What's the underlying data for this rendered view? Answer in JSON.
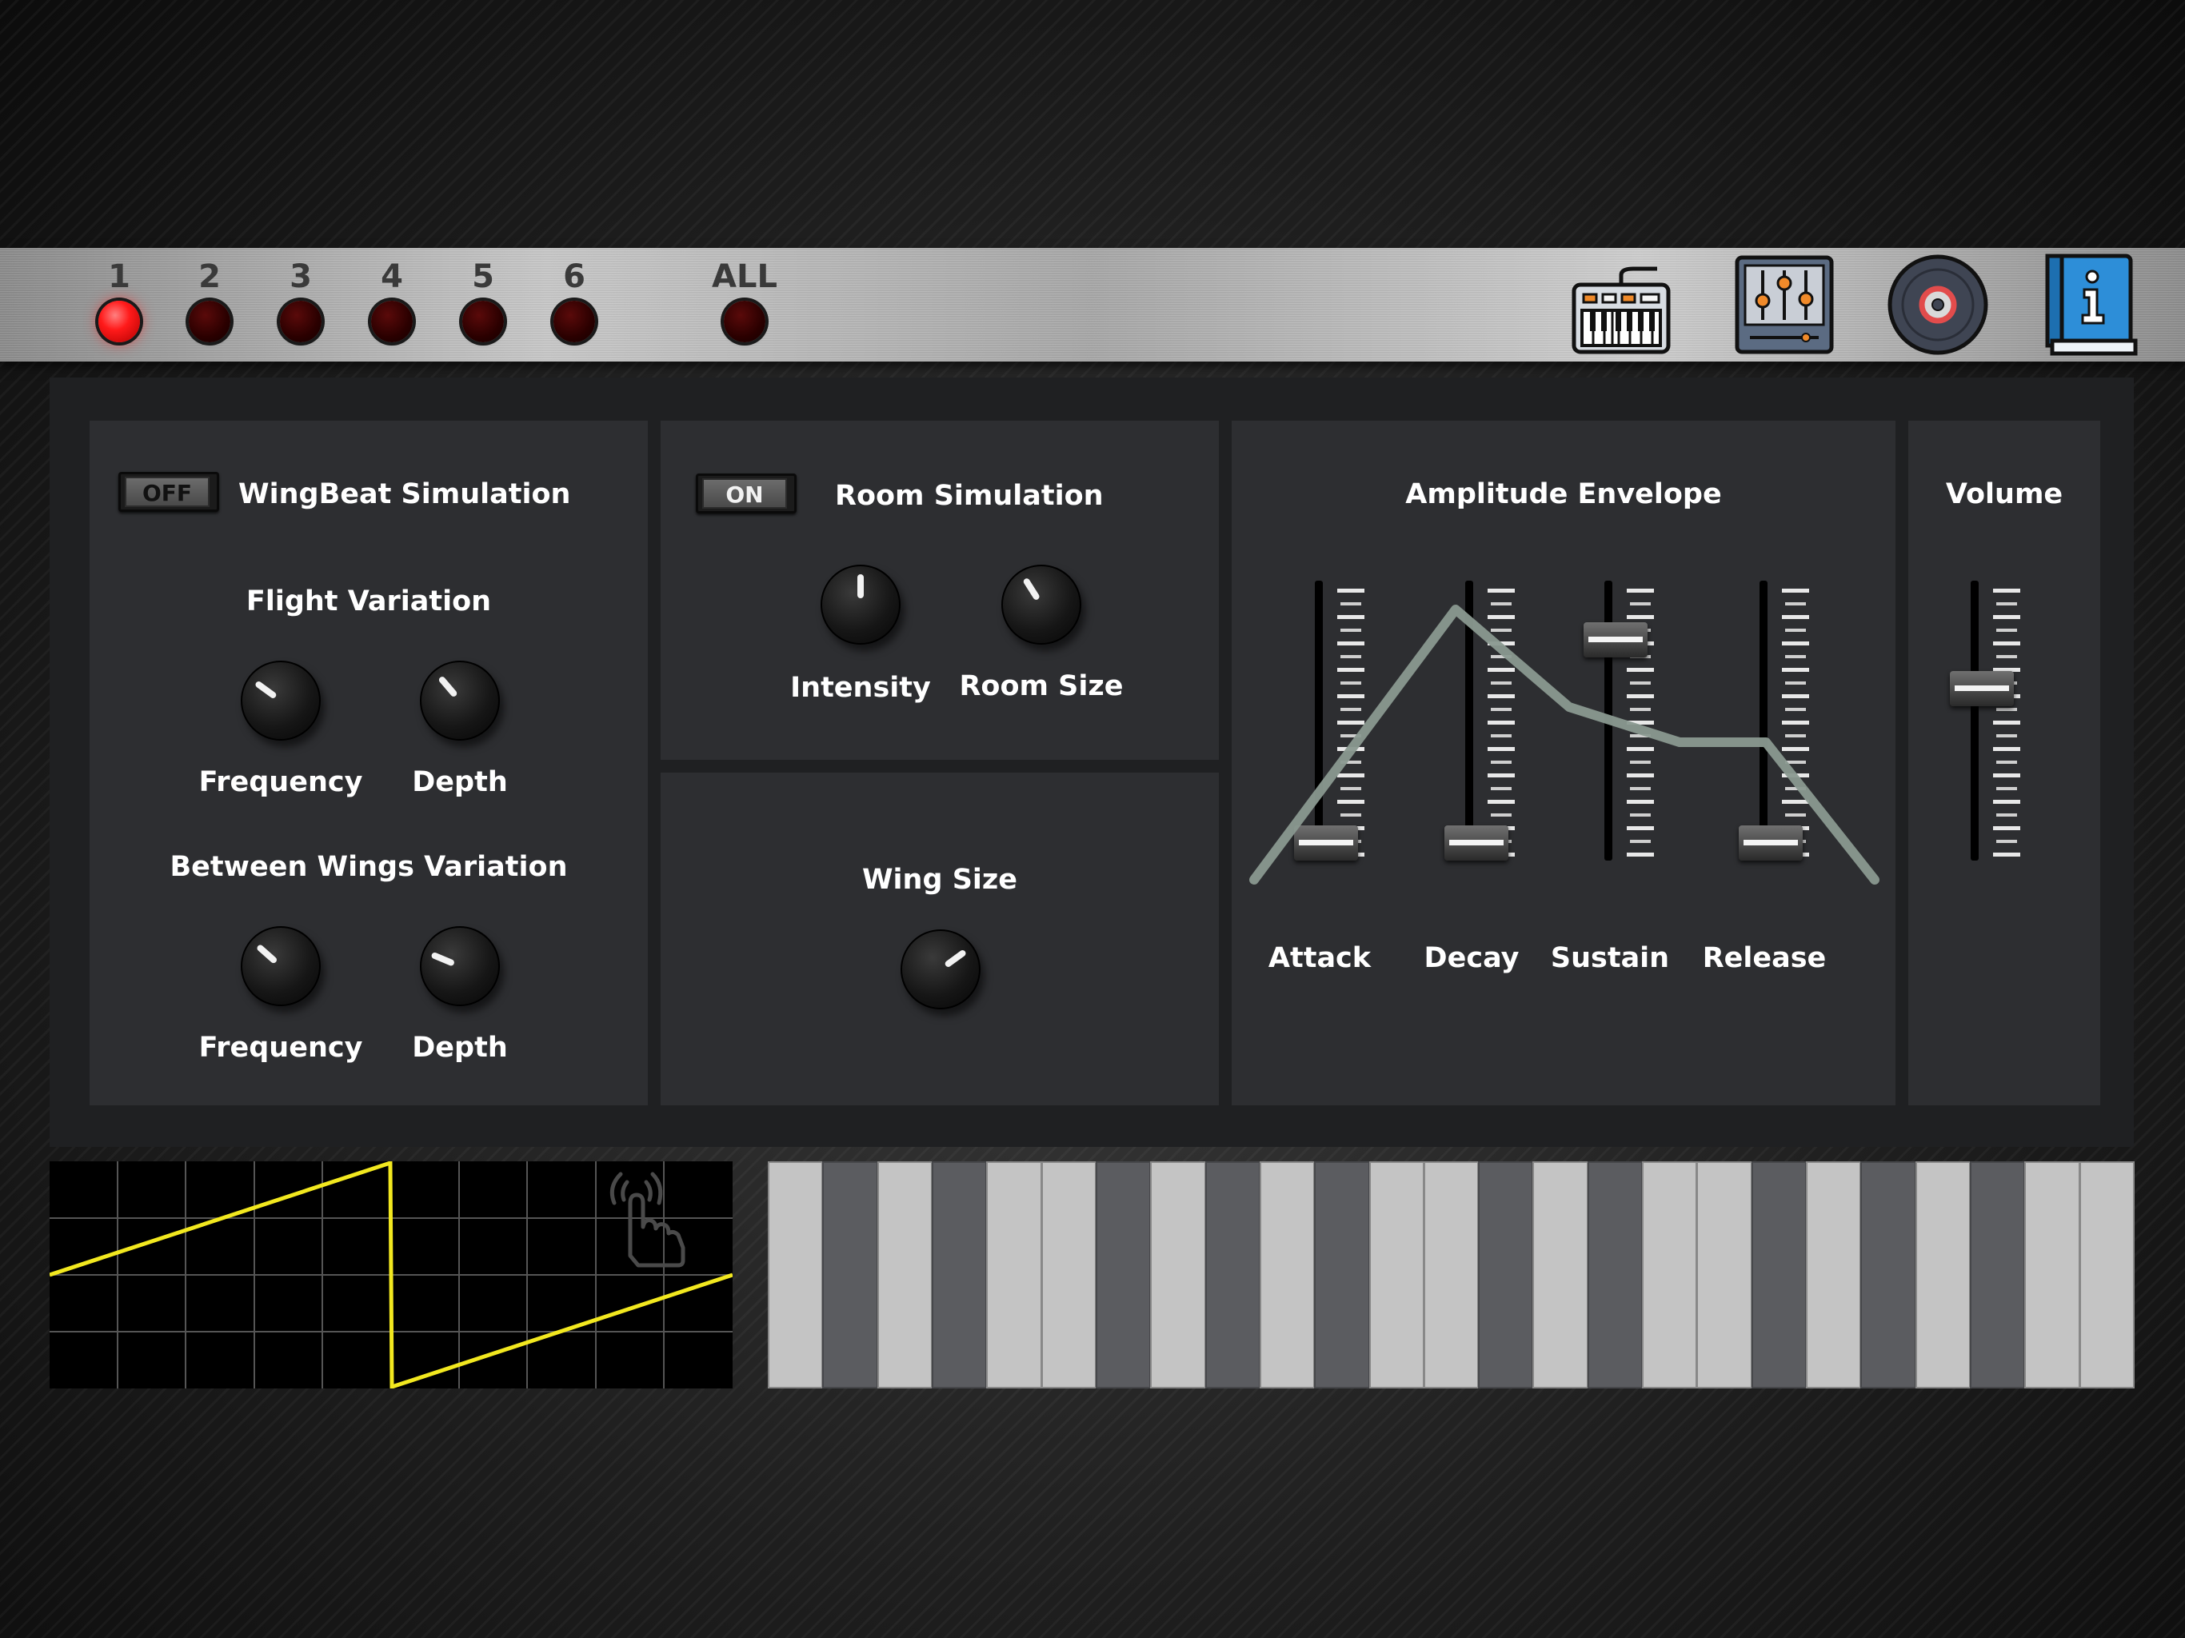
{
  "channels": {
    "items": [
      {
        "label": "1",
        "active": true
      },
      {
        "label": "2",
        "active": false
      },
      {
        "label": "3",
        "active": false
      },
      {
        "label": "4",
        "active": false
      },
      {
        "label": "5",
        "active": false
      },
      {
        "label": "6",
        "active": false
      }
    ],
    "all_label": "ALL"
  },
  "toolbar_icons": [
    "keyboard-icon",
    "mixer-icon",
    "vinyl-record-icon",
    "info-book-icon"
  ],
  "wingbeat": {
    "toggle_label": "OFF",
    "title": "WingBeat Simulation",
    "flight_title": "Flight Variation",
    "flight_frequency_label": "Frequency",
    "flight_depth_label": "Depth",
    "between_title": "Between Wings Variation",
    "between_frequency_label": "Frequency",
    "between_depth_label": "Depth"
  },
  "room": {
    "toggle_label": "ON",
    "title": "Room Simulation",
    "intensity_label": "Intensity",
    "room_size_label": "Room Size"
  },
  "wing": {
    "title": "Wing Size"
  },
  "envelope": {
    "title": "Amplitude Envelope",
    "attack_label": "Attack",
    "decay_label": "Decay",
    "sustain_label": "Sustain",
    "release_label": "Release",
    "levels": {
      "attack": 0.0,
      "decay": 0.0,
      "sustain": 0.83,
      "release": 0.0
    }
  },
  "volume": {
    "title": "Volume",
    "level": 0.63
  },
  "knob_levels": {
    "flight_frequency": 0.3,
    "flight_depth": 0.35,
    "between_frequency": 0.32,
    "between_depth": 0.25,
    "intensity": 0.5,
    "room_size": 0.38,
    "wing_size": 0.7
  },
  "scope": {
    "waveform": "sawtooth",
    "trace_color": "#f2e81f",
    "touch_icon": "touch-hand-icon"
  },
  "keyboard": {
    "keys": [
      "white",
      "black",
      "white",
      "black",
      "white",
      "white",
      "black",
      "white",
      "black",
      "white",
      "black",
      "white",
      "white",
      "black",
      "white",
      "black",
      "white",
      "white",
      "black",
      "white",
      "black",
      "white",
      "black",
      "white",
      "white"
    ]
  },
  "colors": {
    "panel": "#2d2e31",
    "led_on": "#ff1a1a",
    "envelope_curve": "#8a9990"
  }
}
